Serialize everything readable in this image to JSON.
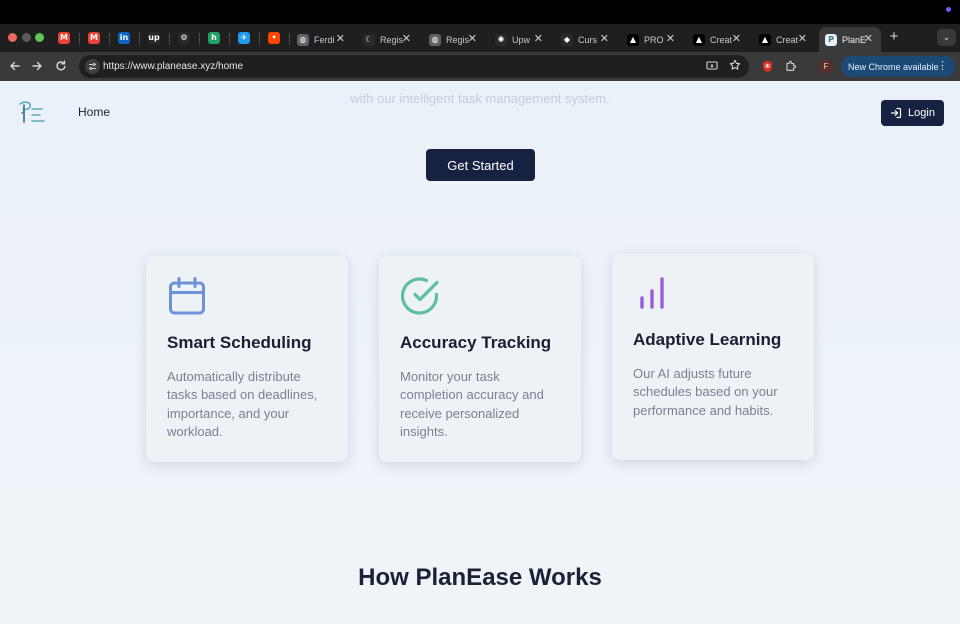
{
  "browser": {
    "pinned_tabs": [
      {
        "icon": "gmail-icon",
        "letter": "M",
        "color": "#ea4335"
      },
      {
        "icon": "gmail-icon",
        "letter": "M",
        "color": "#ea4335"
      },
      {
        "icon": "linkedin-icon",
        "letter": "in",
        "color": "#0a66c2"
      },
      {
        "icon": "upwork-icon",
        "letter": "up",
        "color": "#2a2a2a"
      },
      {
        "icon": "chatgpt-icon",
        "letter": "⚙",
        "color": "#2a2a2a"
      },
      {
        "icon": "app-icon",
        "letter": "h",
        "color": "#21a366"
      },
      {
        "icon": "bird-icon",
        "letter": "✈",
        "color": "#1d9bf0"
      },
      {
        "icon": "reddit-icon",
        "letter": "•",
        "color": "#ff4500"
      }
    ],
    "tabs": [
      {
        "title": "Ferdi",
        "icon": "globe-icon",
        "active": false
      },
      {
        "title": "Regis",
        "icon": "moon-icon",
        "active": false
      },
      {
        "title": "Regis",
        "icon": "globe-icon",
        "active": false
      },
      {
        "title": "Upw",
        "icon": "asterisk-icon",
        "active": false
      },
      {
        "title": "Curs",
        "icon": "cursor-icon",
        "active": false
      },
      {
        "title": "PRO",
        "icon": "triangle-icon",
        "active": false
      },
      {
        "title": "Creat",
        "icon": "triangle-icon",
        "active": false
      },
      {
        "title": "Creat",
        "icon": "triangle-icon",
        "active": false
      },
      {
        "title": "PlanE",
        "icon": "planease-icon",
        "active": true
      }
    ],
    "url": "https://www.planease.xyz/home",
    "profile_initial": "F",
    "update_label": "New Chrome available"
  },
  "page": {
    "faded_text": "with our intelligent task management system.",
    "nav": {
      "home_label": "Home",
      "login_label": "Login"
    },
    "cta_label": "Get Started",
    "features": [
      {
        "icon": "calendar-icon",
        "title": "Smart Scheduling",
        "description": "Automatically distribute tasks based on deadlines, importance, and your workload.",
        "icon_color": "#6d93d6"
      },
      {
        "icon": "check-circle-icon",
        "title": "Accuracy Tracking",
        "description": "Monitor your task completion accuracy and receive personalized insights.",
        "icon_color": "#5cbf9e"
      },
      {
        "icon": "bar-chart-icon",
        "title": "Adaptive Learning",
        "description": "Our AI adjusts future schedules based on your performance and habits.",
        "icon_color": "#9a5bd8"
      }
    ],
    "section_title": "How PlanEase Works"
  }
}
